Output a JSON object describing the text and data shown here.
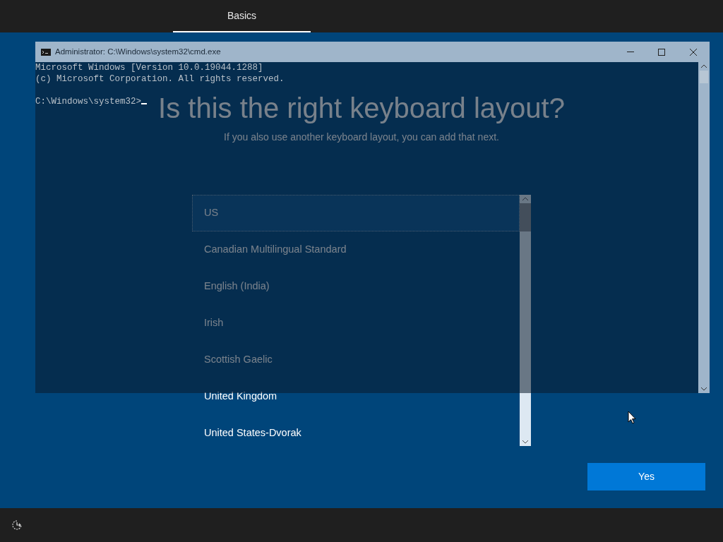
{
  "top_bar": {
    "tabs": [
      {
        "label": "Basics",
        "selected": true
      }
    ]
  },
  "page": {
    "title": "Is this the right keyboard layout?",
    "subtitle": "If you also use another keyboard layout, you can add that next.",
    "layouts": [
      {
        "label": "US",
        "selected": true
      },
      {
        "label": "Canadian Multilingual Standard",
        "selected": false
      },
      {
        "label": "English (India)",
        "selected": false
      },
      {
        "label": "Irish",
        "selected": false
      },
      {
        "label": "Scottish Gaelic",
        "selected": false
      },
      {
        "label": "United Kingdom",
        "selected": false
      },
      {
        "label": "United States-Dvorak",
        "selected": false
      }
    ],
    "buttons": [
      {
        "label": "Yes"
      }
    ]
  },
  "console_window": {
    "title": "Administrator: C:\\Windows\\system32\\cmd.exe",
    "output": [
      "Microsoft Windows [Version 10.0.19044.1288]",
      "(c) Microsoft Corporation. All rights reserved."
    ],
    "prompt": "C:\\Windows\\system32>"
  }
}
